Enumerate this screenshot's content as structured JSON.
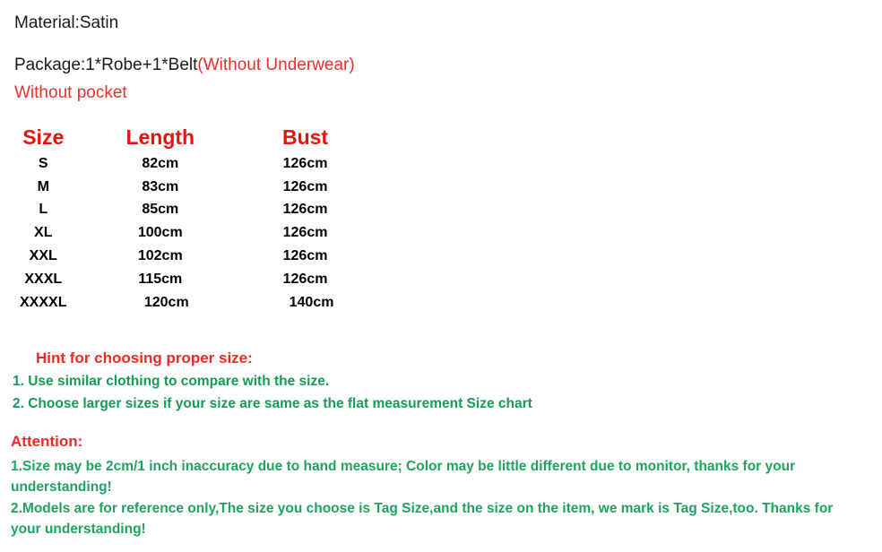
{
  "intro": {
    "material": "Material:Satin",
    "package_main": "Package:1*Robe+1*Belt",
    "package_note": "(Without Underwear)",
    "pocket_note": "Without pocket"
  },
  "size_chart": {
    "headers": [
      "Size",
      "Length",
      "Bust"
    ],
    "rows": [
      {
        "size": "S",
        "length": "82cm",
        "bust": "126cm"
      },
      {
        "size": "M",
        "length": "83cm",
        "bust": "126cm"
      },
      {
        "size": "L",
        "length": "85cm",
        "bust": "126cm"
      },
      {
        "size": "XL",
        "length": "100cm",
        "bust": "126cm"
      },
      {
        "size": "XXL",
        "length": "102cm",
        "bust": "126cm"
      },
      {
        "size": "XXXL",
        "length": "115cm",
        "bust": "126cm"
      },
      {
        "size": "XXXXL",
        "length": "120cm",
        "bust": "140cm"
      }
    ]
  },
  "hint": {
    "title": "Hint for choosing proper size:",
    "line_1": "1. Use similar clothing to compare with the size.",
    "line_2": "2. Choose larger sizes if your size are same as the flat measurement Size chart"
  },
  "attention": {
    "title": "Attention:",
    "item_1": "1.Size may be 2cm/1 inch inaccuracy due to hand measure; Color may be little different   due to monitor, thanks for your understanding!",
    "item_2": "2.Models are for reference only,The size you choose is Tag Size,and the size on the item,  we mark is Tag Size,too. Thanks for your understanding!"
  },
  "colors": {
    "red_heading": "#e8130f",
    "red_note": "#ee2b22",
    "green_text": "#20a35f",
    "black_text": "#1a1a1a",
    "background": "#ffffff"
  }
}
